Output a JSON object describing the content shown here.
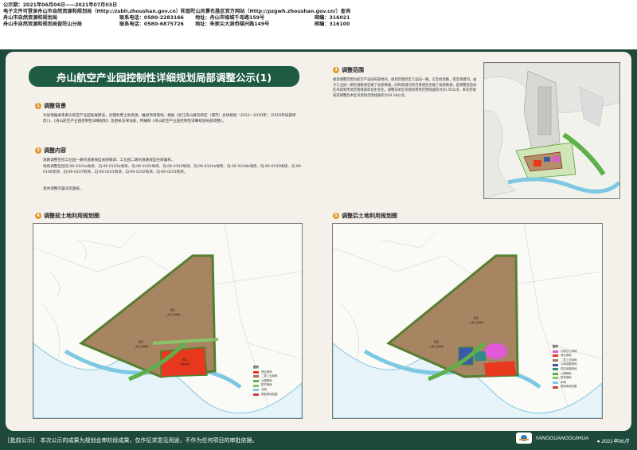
{
  "header": {
    "line1": "公示期：2021年06月04日——2021年07月03日",
    "line2": "电子文件可登录舟山市自然资源和规划局（Http://zsblr.zhoushan.gov.cn）和普陀山风景名胜区官方网站（Http://pzgwh.zhoushan.gov.cn/）查询",
    "org1": "舟山市自然资源和规划局",
    "org1_phone": "联系电话：0580-2283166",
    "org1_addr": "地址：舟山市临城千岛路159号",
    "org1_zip": "邮编：316021",
    "org2": "舟山市自然资源和规划局普陀山分局",
    "org2_phone": "联系电话：0580-6875726",
    "org2_addr": "地址：朱家尖大洞岙福兴路149号",
    "org2_zip": "邮编：316100"
  },
  "title": "舟山航空产业园控制性详细规划局部调整公示(1)",
  "sections": {
    "s1": {
      "num": "1",
      "heading": "调整背景",
      "text": "为加快推进朱家尖航空产业园发展建设，合理利用土地资源，推进项目落地，根据《浙江舟山群岛新区（城市）总体规划（2012—2030年）（2018年局部修改）》、《舟山航空产业园控制性详细规划》及相关法律法规，特编制《舟山航空产业园控制性详细规划局部调整》。"
    },
    "s2": {
      "num": "2",
      "heading": "调整内容",
      "t1": "道路调整包括工业园一路的道路线型局部微调、工业园二路的道路线型往南偏移。",
      "t2": "地块调整包括ZJ-06-0101a地块、ZJ-06-0101b地块、ZJ-06-0102地块、ZJ-06-0103地块、ZJ-06-0104a地块、ZJ-06-0104b地块、ZJ-06-0105地块、ZJ-06-0106地块、ZJ-06-0107地块、ZJ-06-0201地块、ZJ-06-0202地块、ZJ-06-0203地块。",
      "t3": "具体调整内容详见图纸。"
    },
    "s3": {
      "num": "3",
      "heading": "调整范围",
      "text": "规划调整范围为航空产业园局部地块，规划范围西至工业园一路，东至机场路，南至南塘河。由于工业园一路的道路线型做了局部微调，同时南塘河的河道线型也做了局部微调，使调整前后本区块规划用地范围线面积发生变化。调整前本区块规划用地范围线面积为40.45公顷，本次控规局部调整后本区块用地范围线面积为39.18公顷。"
    },
    "s4": {
      "num": "4",
      "heading": "调整前土地利用规划图"
    },
    "s5": {
      "num": "5",
      "heading": "调整后土地利用规划图"
    }
  },
  "map_labels": {
    "m2": "M2",
    "m2_desc": "二类工业用地",
    "b1": "B1",
    "b1_desc": "商业用地"
  },
  "legend_before": [
    {
      "label": "商业用地",
      "color": "#e8391f"
    },
    {
      "label": "二类工业用地",
      "color": "#9c7a5a"
    },
    {
      "label": "公园绿地",
      "color": "#5fb04a"
    },
    {
      "label": "防护绿地",
      "color": "#8ac46a"
    },
    {
      "label": "水域",
      "color": "#7ec8e3"
    },
    {
      "label": "规划用地范围",
      "color": "#d04040"
    }
  ],
  "legend_after": [
    {
      "label": "行政办公用地",
      "color": "#e05ad8"
    },
    {
      "label": "商业用地",
      "color": "#e8391f"
    },
    {
      "label": "二类工业用地",
      "color": "#9c7a5a"
    },
    {
      "label": "公用设施用地",
      "color": "#3a5aa8"
    },
    {
      "label": "供应设施用地",
      "color": "#2f8a8a"
    },
    {
      "label": "公园绿地",
      "color": "#5fb04a"
    },
    {
      "label": "防护绿地",
      "color": "#8ac46a"
    },
    {
      "label": "水域",
      "color": "#7ec8e3"
    },
    {
      "label": "规划用地范围",
      "color": "#d04040"
    }
  ],
  "legend_title": "图例",
  "footer": {
    "notice": "[批前公示]　本次公示的成果为规划会审阶段成果，仅作征求意见用途，不作为任何项目的审批依据。",
    "brand": "YANGGUANGGUIHUA",
    "date": "● 2021年06月"
  },
  "colors": {
    "dark_green": "#1d4a3a",
    "title_bg": "#1f5a43",
    "accent_orange": "#e5962c"
  }
}
